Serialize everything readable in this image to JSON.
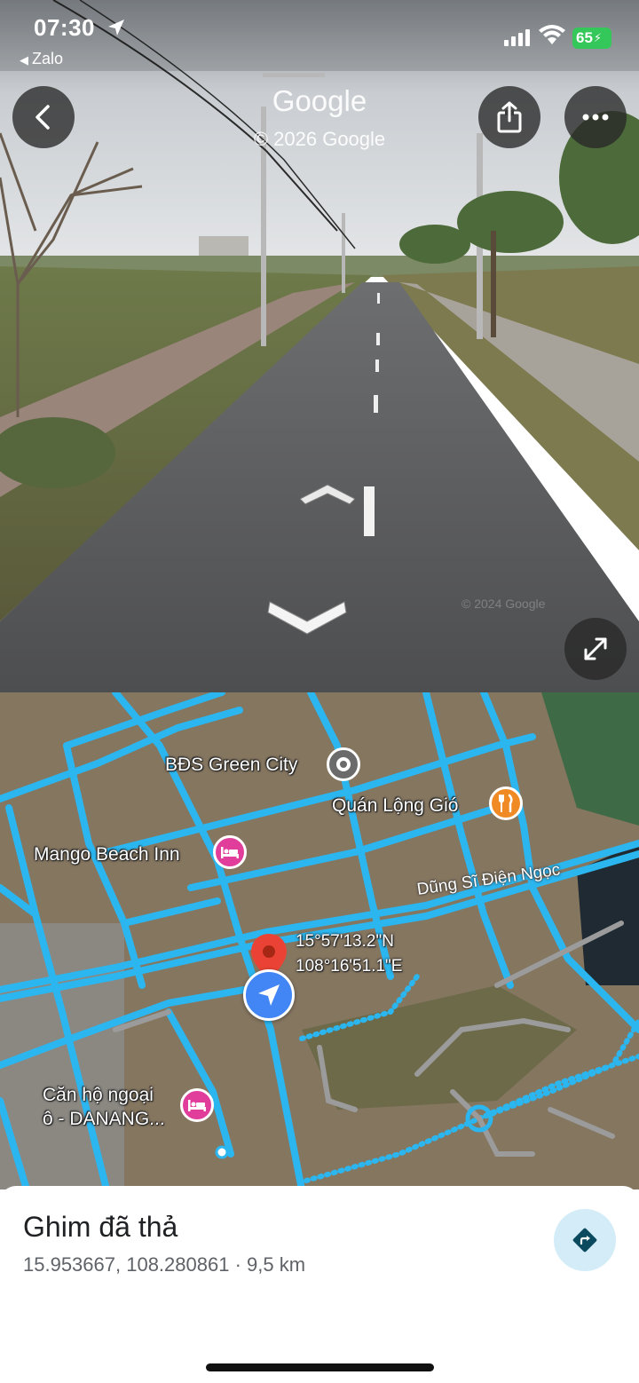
{
  "status_bar": {
    "time": "07:30",
    "back_app": "Zalo",
    "battery": "65"
  },
  "street_view": {
    "logo": "Google",
    "copyright": "© 2026 Google",
    "watermark": "© 2024 Google",
    "buttons": {
      "back": "chevron-left-icon",
      "share": "share-icon",
      "more": "more-horizontal-icon",
      "expand": "expand-icon"
    }
  },
  "map": {
    "pois": [
      {
        "label": "BĐS Green City",
        "icon": "place-icon",
        "color": "#6b6b6b"
      },
      {
        "label": "Quán Lộng Gió",
        "icon": "restaurant-icon",
        "color": "#f08a24"
      },
      {
        "label": "Mango Beach Inn",
        "icon": "hotel-icon",
        "color": "#e13d9b"
      },
      {
        "label": "Căn hộ ngoại",
        "label_line2": "ô - DANANG...",
        "icon": "hotel-icon",
        "color": "#e13d9b"
      }
    ],
    "road_label": "Dũng Sĩ Điện Ngọc",
    "dropped_pin": {
      "lat": "15°57'13.2\"N",
      "lng": "108°16'51.1\"E"
    },
    "accent_color": "#2bb6f0"
  },
  "sheet": {
    "title": "Ghim đã thả",
    "subtitle": "15.953667, 108.280861 · 9,5 km"
  }
}
